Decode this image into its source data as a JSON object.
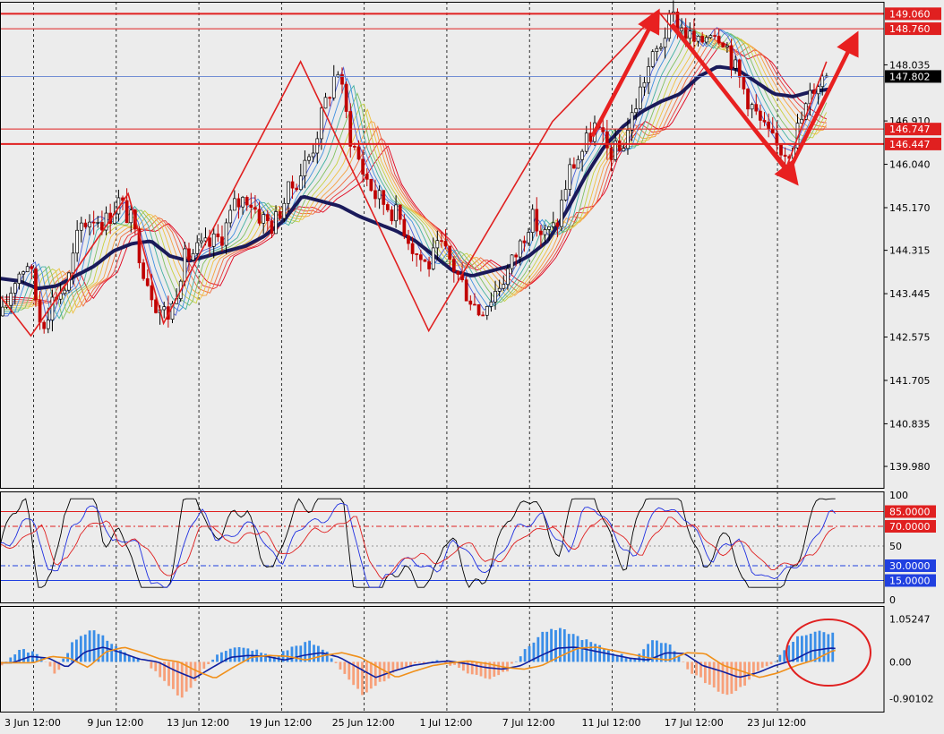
{
  "chart_data": [
    {
      "type": "candlestick",
      "title": "",
      "ylim": [
        139.55,
        149.3
      ],
      "price_ticks": [
        "148.035",
        "146.910",
        "146.040",
        "145.170",
        "144.315",
        "143.445",
        "142.575",
        "141.705",
        "140.835",
        "139.980"
      ],
      "horizontal_lines": [
        {
          "value": 149.06,
          "label": "149.060",
          "color": "#e02020",
          "weight": "bold"
        },
        {
          "value": 148.76,
          "label": "148.760",
          "color": "#e02020",
          "weight": "thin"
        },
        {
          "value": 146.747,
          "label": "146.747",
          "color": "#e02020",
          "weight": "thin"
        },
        {
          "value": 146.447,
          "label": "146.447",
          "color": "#e02020",
          "weight": "bold"
        }
      ],
      "current_price": {
        "value": 147.802,
        "label": "147.802"
      },
      "swing_points": [
        {
          "t": 0.0,
          "p": 143.4
        },
        {
          "t": 0.035,
          "p": 142.6
        },
        {
          "t": 0.145,
          "p": 145.45
        },
        {
          "t": 0.185,
          "p": 142.85
        },
        {
          "t": 0.34,
          "p": 148.1
        },
        {
          "t": 0.485,
          "p": 142.7
        },
        {
          "t": 0.625,
          "p": 146.9
        },
        {
          "t": 0.745,
          "p": 149.1
        },
        {
          "t": 0.89,
          "p": 146.0
        },
        {
          "t": 0.935,
          "p": 148.1
        }
      ],
      "candles_seed": [
        143.0,
        143.8,
        144.1,
        142.8,
        143.4,
        143.6,
        144.8,
        145.0,
        144.9,
        145.3,
        144.9,
        143.9,
        143.2,
        143.0,
        144.1,
        144.3,
        144.4,
        144.6,
        145.2,
        145.4,
        145.0,
        144.8,
        145.4,
        145.8,
        146.3,
        147.2,
        148.0,
        146.6,
        145.9,
        145.4,
        145.2,
        144.9,
        144.3,
        144.0,
        144.4,
        144.0,
        143.5,
        143.1,
        143.4,
        143.8,
        144.3,
        145.0,
        144.6,
        144.8,
        145.9,
        146.3,
        146.8,
        146.3,
        146.3,
        147.1,
        147.9,
        148.4,
        149.0,
        148.7,
        148.4,
        148.8,
        148.6,
        147.9,
        147.3,
        146.8,
        146.4,
        146.3,
        146.9,
        147.6,
        147.9
      ],
      "ma_thick_seed": [
        143.75,
        143.7,
        143.55,
        143.6,
        143.8,
        144.0,
        144.3,
        144.45,
        144.5,
        144.2,
        144.1,
        144.2,
        144.3,
        144.4,
        144.6,
        144.9,
        145.4,
        145.3,
        145.2,
        145.0,
        144.85,
        144.7,
        144.5,
        144.2,
        143.9,
        143.8,
        143.9,
        144.0,
        144.2,
        144.5,
        145.1,
        145.8,
        146.4,
        146.8,
        147.1,
        147.3,
        147.45,
        147.8,
        148.0,
        147.95,
        147.7,
        147.45,
        147.4,
        147.5,
        147.55
      ],
      "ribbon_colors": [
        "#e0001b",
        "#e83838",
        "#f06a3a",
        "#f5a040",
        "#f0c040",
        "#c8d040",
        "#80c060",
        "#40b0a0",
        "#3f8fe0",
        "#4a5fd8"
      ],
      "oscillator": {
        "ticks": [
          "100",
          "50",
          "0"
        ],
        "levels": [
          {
            "value": 85,
            "label": "85.0000",
            "color": "#e02020",
            "style": "solid"
          },
          {
            "value": 70,
            "label": "70.0000",
            "color": "#e02020",
            "style": "dashdot"
          },
          {
            "value": 30,
            "label": "30.0000",
            "color": "#2040e0",
            "style": "dashdot"
          },
          {
            "value": 15,
            "label": "15.0000",
            "color": "#2040e0",
            "style": "solid"
          }
        ],
        "ylim": [
          0,
          100
        ]
      },
      "macd": {
        "ticks": [
          "1.05247",
          "0.00",
          "-0.90102"
        ],
        "ylim": [
          -1.0,
          1.15
        ],
        "hist_seed": [
          -0.05,
          0.3,
          0.2,
          -0.3,
          0.55,
          0.8,
          0.5,
          0.15,
          0.0,
          -0.5,
          -0.9,
          -0.3,
          0.25,
          0.35,
          0.3,
          0.1,
          0.35,
          0.5,
          0.25,
          -0.3,
          -0.85,
          -0.5,
          -0.2,
          -0.05,
          0.05,
          -0.1,
          -0.3,
          -0.4,
          -0.2,
          0.3,
          0.75,
          0.8,
          0.6,
          0.4,
          0.2,
          0.1,
          0.5,
          0.45,
          -0.2,
          -0.5,
          -0.85,
          -0.6,
          -0.2,
          0.1,
          0.6,
          0.75,
          0.7
        ]
      },
      "x_labels": [
        "3 Jun 12:00",
        "9 Jun 12:00",
        "13 Jun 12:00",
        "19 Jun 12:00",
        "25 Jun 12:00",
        "1 Jul 12:00",
        "7 Jul 12:00",
        "11 Jul 12:00",
        "17 Jul 12:00",
        "23 Jul 12:00"
      ]
    }
  ]
}
